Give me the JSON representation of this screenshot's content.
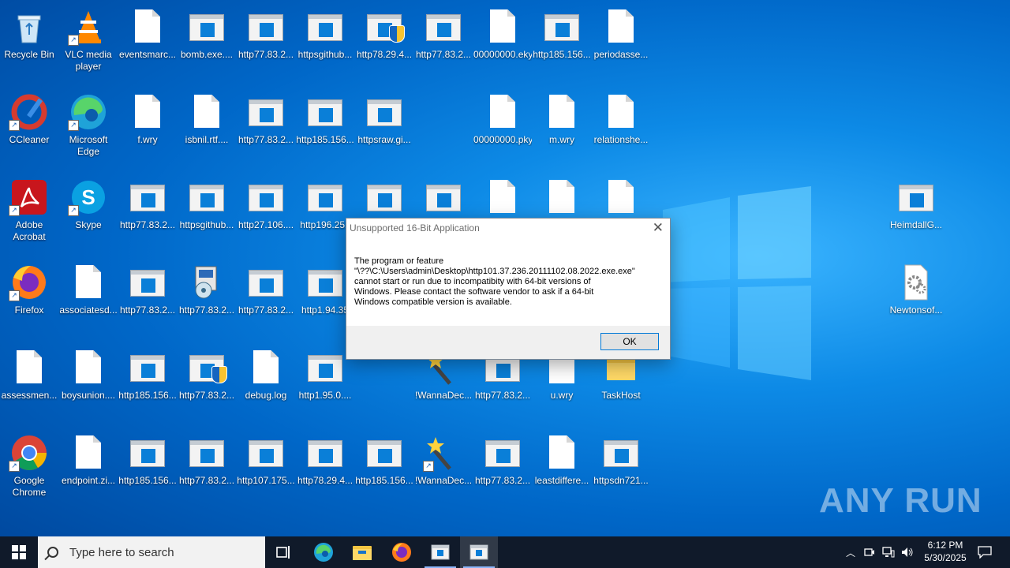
{
  "desktop": {
    "icons": [
      {
        "label": "Recycle Bin",
        "type": "recycle"
      },
      {
        "label": "VLC media player",
        "type": "vlc",
        "shortcut": true
      },
      {
        "label": "eventsmarc...",
        "type": "doc"
      },
      {
        "label": "bomb.exe....",
        "type": "app"
      },
      {
        "label": "http77.83.2...",
        "type": "app"
      },
      {
        "label": "httpsgithub...",
        "type": "app"
      },
      {
        "label": "http78.29.4...",
        "type": "app",
        "shield": true
      },
      {
        "label": "http77.83.2...",
        "type": "app"
      },
      {
        "label": "00000000.eky",
        "type": "doc"
      },
      {
        "label": "http185.156...",
        "type": "app"
      },
      {
        "label": "periodasse...",
        "type": "doc"
      },
      {
        "label": "CCleaner",
        "type": "ccleaner",
        "shortcut": true
      },
      {
        "label": "Microsoft Edge",
        "type": "edge",
        "shortcut": true
      },
      {
        "label": "f.wry",
        "type": "doc"
      },
      {
        "label": "isbnil.rtf....",
        "type": "doc"
      },
      {
        "label": "http77.83.2...",
        "type": "app"
      },
      {
        "label": "http185.156...",
        "type": "app"
      },
      {
        "label": "httpsraw.gi...",
        "type": "app"
      },
      {
        "label": "00000000.pky",
        "type": "doc"
      },
      {
        "label": "m.wry",
        "type": "doc"
      },
      {
        "label": "relationshe...",
        "type": "doc"
      },
      {
        "label": "Adobe Acrobat",
        "type": "acrobat",
        "shortcut": true
      },
      {
        "label": "Skype",
        "type": "skype",
        "shortcut": true
      },
      {
        "label": "http77.83.2...",
        "type": "app"
      },
      {
        "label": "httpsgithub...",
        "type": "app"
      },
      {
        "label": "http27.106....",
        "type": "app"
      },
      {
        "label": "http196.251",
        "type": "app"
      },
      {
        "label": "",
        "type": "app"
      },
      {
        "label": "",
        "type": "app"
      },
      {
        "label": "",
        "type": "doc"
      },
      {
        "label": "",
        "type": "doc"
      },
      {
        "label": "",
        "type": "doc"
      },
      {
        "label": "HeimdallG...",
        "type": "app"
      },
      {
        "label": "Firefox",
        "type": "firefox",
        "shortcut": true
      },
      {
        "label": "associatesd...",
        "type": "doc"
      },
      {
        "label": "http77.83.2...",
        "type": "app"
      },
      {
        "label": "http77.83.2...",
        "type": "setup"
      },
      {
        "label": "http77.83.2...",
        "type": "app"
      },
      {
        "label": "http1.94.35",
        "type": "app"
      },
      {
        "label": "Newtonsof...",
        "type": "gear"
      },
      {
        "label": "assessmen...",
        "type": "doc"
      },
      {
        "label": "boysunion....",
        "type": "doc"
      },
      {
        "label": "http185.156...",
        "type": "app"
      },
      {
        "label": "http77.83.2...",
        "type": "app",
        "shield": true
      },
      {
        "label": "debug.log",
        "type": "doc"
      },
      {
        "label": "http1.95.0....",
        "type": "app"
      },
      {
        "label": "!WannaDec...",
        "type": "wand"
      },
      {
        "label": "http77.83.2...",
        "type": "app"
      },
      {
        "label": "u.wry",
        "type": "doc"
      },
      {
        "label": "TaskHost",
        "type": "folder"
      },
      {
        "label": "Google Chrome",
        "type": "chrome",
        "shortcut": true
      },
      {
        "label": "endpoint.zi...",
        "type": "doc"
      },
      {
        "label": "http185.156...",
        "type": "app"
      },
      {
        "label": "http77.83.2...",
        "type": "app"
      },
      {
        "label": "http107.175...",
        "type": "app"
      },
      {
        "label": "http78.29.4...",
        "type": "app"
      },
      {
        "label": "http185.156...",
        "type": "app"
      },
      {
        "label": "!WannaDec...",
        "type": "wand",
        "shortcut": true
      },
      {
        "label": "http77.83.2...",
        "type": "app"
      },
      {
        "label": "leastdiffere...",
        "type": "doc"
      },
      {
        "label": "httpsdn721...",
        "type": "app"
      }
    ]
  },
  "dialog": {
    "title": "Unsupported 16-Bit Application",
    "message_lines": [
      "The program or feature",
      "\"\\??\\C:\\Users\\admin\\Desktop\\http101.37.236.20111102.08.2022.exe.exe\"",
      "cannot start or run due to incompatibity with 64-bit versions of",
      "Windows. Please contact the software vendor to ask if a 64-bit",
      "Windows compatible version is available."
    ],
    "ok_label": "OK",
    "close_icon": "close-icon"
  },
  "watermark": "ANY RUN",
  "taskbar": {
    "search_placeholder": "Type here to search",
    "clock_time": "6:12 PM",
    "clock_date": "5/30/2025",
    "items": [
      "task-view-icon",
      "edge-icon",
      "file-explorer-icon",
      "firefox-icon",
      "app-window-icon",
      "app-window-icon"
    ]
  },
  "colors": {
    "accent": "#0078d7",
    "taskbar": "#101a2a",
    "desktop": "#0a7fd8"
  }
}
